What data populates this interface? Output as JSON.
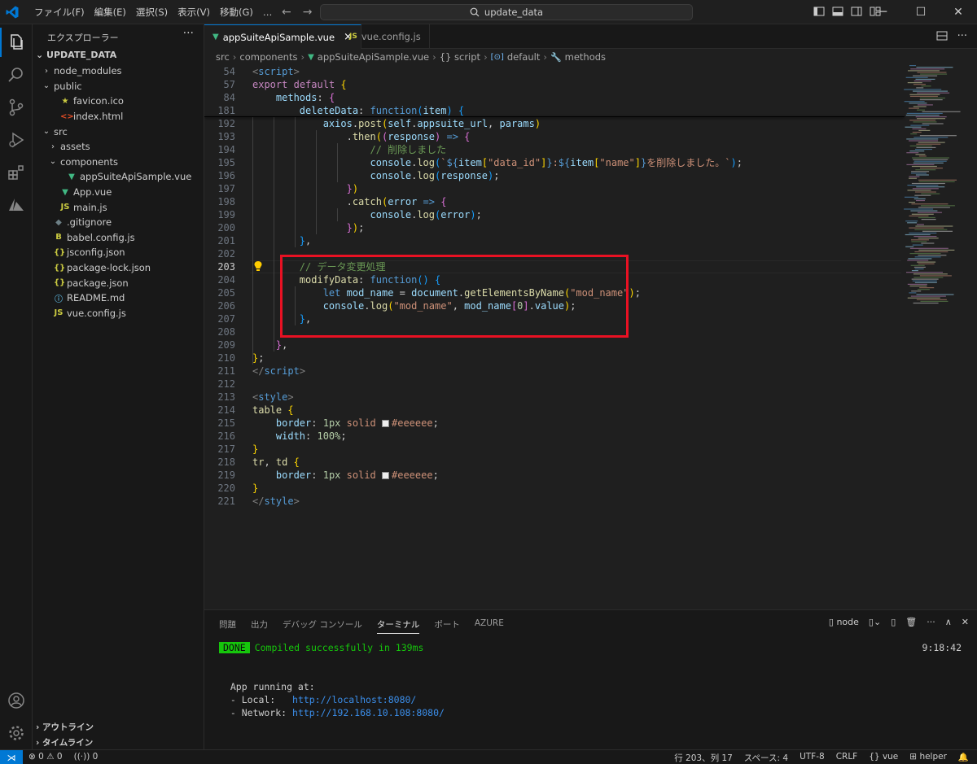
{
  "titlebar": {
    "menus": [
      "ファイル(F)",
      "編集(E)",
      "選択(S)",
      "表示(V)",
      "移動(G)",
      "…"
    ],
    "search_text": "update_data"
  },
  "sidebar": {
    "title": "エクスプローラー",
    "root": "UPDATE_DATA",
    "items": [
      {
        "label": "node_modules",
        "indent": 0,
        "chev": "›",
        "icon": "",
        "color": "#cccccc"
      },
      {
        "label": "public",
        "indent": 0,
        "chev": "⌄",
        "icon": "",
        "color": "#cccccc"
      },
      {
        "label": "favicon.ico",
        "indent": 1,
        "chev": "",
        "icon": "★",
        "color": "#cbcb41"
      },
      {
        "label": "index.html",
        "indent": 1,
        "chev": "",
        "icon": "<>",
        "color": "#e44d26"
      },
      {
        "label": "src",
        "indent": 0,
        "chev": "⌄",
        "icon": "",
        "color": "#cccccc"
      },
      {
        "label": "assets",
        "indent": 1,
        "chev": "›",
        "icon": "",
        "color": "#cccccc"
      },
      {
        "label": "components",
        "indent": 1,
        "chev": "⌄",
        "icon": "",
        "color": "#cccccc"
      },
      {
        "label": "appSuiteApiSample.vue",
        "indent": 2,
        "chev": "",
        "icon": "▼",
        "color": "#41b883"
      },
      {
        "label": "App.vue",
        "indent": 1,
        "chev": "",
        "icon": "▼",
        "color": "#41b883"
      },
      {
        "label": "main.js",
        "indent": 1,
        "chev": "",
        "icon": "JS",
        "color": "#cbcb41"
      },
      {
        "label": ".gitignore",
        "indent": 0,
        "chev": "",
        "icon": "◆",
        "color": "#6d8086"
      },
      {
        "label": "babel.config.js",
        "indent": 0,
        "chev": "",
        "icon": "B",
        "color": "#cbcb41"
      },
      {
        "label": "jsconfig.json",
        "indent": 0,
        "chev": "",
        "icon": "{}",
        "color": "#cbcb41"
      },
      {
        "label": "package-lock.json",
        "indent": 0,
        "chev": "",
        "icon": "{}",
        "color": "#cbcb41"
      },
      {
        "label": "package.json",
        "indent": 0,
        "chev": "",
        "icon": "{}",
        "color": "#cbcb41"
      },
      {
        "label": "README.md",
        "indent": 0,
        "chev": "",
        "icon": "ⓘ",
        "color": "#519aba"
      },
      {
        "label": "vue.config.js",
        "indent": 0,
        "chev": "",
        "icon": "JS",
        "color": "#cbcb41"
      }
    ],
    "outline": "アウトライン",
    "timeline": "タイムライン"
  },
  "tabs": [
    {
      "label": "appSuiteApiSample.vue",
      "icon": "▼",
      "close": "×"
    },
    {
      "label": "vue.config.js",
      "icon": "JS"
    }
  ],
  "breadcrumb": {
    "src": "src",
    "components": "components",
    "file": "appSuiteApiSample.vue",
    "script": "{} script",
    "default": "default",
    "methods": "methods"
  },
  "code": {
    "lines": [
      {
        "n": "54",
        "html": "<span class=\"t\">&lt;</span><span class=\"tag\">script</span><span class=\"t\">&gt;</span>"
      },
      {
        "n": "57",
        "html": "<span class=\"c\">export</span> <span class=\"c\">default</span> <span class=\"b1\">{</span>"
      },
      {
        "n": "84",
        "html": "    <span class=\"v\">methods</span>: <span class=\"b2\">{</span>"
      },
      {
        "n": "181",
        "html": "        <span class=\"v\">deleteData</span>: <span class=\"k\">function</span><span class=\"b3\">(</span><span class=\"v\">item</span><span class=\"b3\">)</span> <span class=\"b3\">{</span>"
      },
      {
        "n": "192",
        "html": "            <span class=\"v\">axios</span>.<span class=\"f\">post</span><span class=\"b1\">(</span><span class=\"v\">self</span>.<span class=\"v\">appsuite_url</span>, <span class=\"v\">params</span><span class=\"b1\">)</span>"
      },
      {
        "n": "193",
        "html": "                .<span class=\"f\">then</span><span class=\"b1\">(</span><span class=\"b2\">(</span><span class=\"v\">response</span><span class=\"b2\">)</span> <span class=\"k\">=&gt;</span> <span class=\"b2\">{</span>"
      },
      {
        "n": "194",
        "html": "                    <span class=\"cm\">// 削除しました</span>"
      },
      {
        "n": "195",
        "html": "                    <span class=\"v\">console</span>.<span class=\"f\">log</span><span class=\"b3\">(</span><span class=\"s\">`</span><span class=\"k\">${</span><span class=\"v\">item</span><span class=\"b1\">[</span><span class=\"s\">\"data_id\"</span><span class=\"b1\">]</span><span class=\"k\">}</span><span class=\"s\">:</span><span class=\"k\">${</span><span class=\"v\">item</span><span class=\"b1\">[</span><span class=\"s\">\"name\"</span><span class=\"b1\">]</span><span class=\"k\">}</span><span class=\"s\">を削除しました。`</span><span class=\"b3\">)</span>;"
      },
      {
        "n": "196",
        "html": "                    <span class=\"v\">console</span>.<span class=\"f\">log</span><span class=\"b3\">(</span><span class=\"v\">response</span><span class=\"b3\">)</span>;"
      },
      {
        "n": "197",
        "html": "                <span class=\"b2\">}</span><span class=\"b1\">)</span>"
      },
      {
        "n": "198",
        "html": "                .<span class=\"f\">catch</span><span class=\"b1\">(</span><span class=\"v\">error</span> <span class=\"k\">=&gt;</span> <span class=\"b2\">{</span>"
      },
      {
        "n": "199",
        "html": "                    <span class=\"v\">console</span>.<span class=\"f\">log</span><span class=\"b3\">(</span><span class=\"v\">error</span><span class=\"b3\">)</span>;"
      },
      {
        "n": "200",
        "html": "                <span class=\"b2\">}</span><span class=\"b1\">)</span>;"
      },
      {
        "n": "201",
        "html": "        <span class=\"b3\">}</span>,"
      },
      {
        "n": "202",
        "html": ""
      },
      {
        "n": "203",
        "html": "        <span class=\"cm\">// データ変更処理</span>"
      },
      {
        "n": "204",
        "html": "        <span class=\"f\">modifyData</span>: <span class=\"k\">function</span><span class=\"b3\">()</span> <span class=\"b3\">{</span>"
      },
      {
        "n": "205",
        "html": "            <span class=\"k\">let</span> <span class=\"v\">mod_name</span> = <span class=\"v\">document</span>.<span class=\"f\">getElementsByName</span><span class=\"b1\">(</span><span class=\"s\">\"mod_name\"</span><span class=\"b1\">)</span>;"
      },
      {
        "n": "206",
        "html": "            <span class=\"v\">console</span>.<span class=\"f\">log</span><span class=\"b1\">(</span><span class=\"s\">\"mod_name\"</span>, <span class=\"v\">mod_name</span><span class=\"b2\">[</span><span class=\"n\">0</span><span class=\"b2\">]</span>.<span class=\"v\">value</span><span class=\"b1\">)</span>;"
      },
      {
        "n": "207",
        "html": "        <span class=\"b3\">}</span>,"
      },
      {
        "n": "208",
        "html": ""
      },
      {
        "n": "209",
        "html": "    <span class=\"b2\">}</span>,"
      },
      {
        "n": "210",
        "html": "<span class=\"b1\">}</span>;"
      },
      {
        "n": "211",
        "html": "<span class=\"t\">&lt;/</span><span class=\"tag\">script</span><span class=\"t\">&gt;</span>"
      },
      {
        "n": "212",
        "html": ""
      },
      {
        "n": "213",
        "html": "<span class=\"t\">&lt;</span><span class=\"tag\">style</span><span class=\"t\">&gt;</span>"
      },
      {
        "n": "214",
        "html": "<span class=\"f\">table</span> <span class=\"b1\">{</span>"
      },
      {
        "n": "215",
        "html": "    <span class=\"v\">border</span>: <span class=\"n\">1px</span> <span class=\"s\">solid</span> <span class=\"sq\"></span><span class=\"s\">#eeeeee</span>;"
      },
      {
        "n": "216",
        "html": "    <span class=\"v\">width</span>: <span class=\"n\">100%</span>;"
      },
      {
        "n": "217",
        "html": "<span class=\"b1\">}</span>"
      },
      {
        "n": "218",
        "html": "<span class=\"f\">tr</span>, <span class=\"f\">td</span> <span class=\"b1\">{</span>"
      },
      {
        "n": "219",
        "html": "    <span class=\"v\">border</span>: <span class=\"n\">1px</span> <span class=\"s\">solid</span> <span class=\"sq\"></span><span class=\"s\">#eeeeee</span>;"
      },
      {
        "n": "220",
        "html": "<span class=\"b1\">}</span>"
      },
      {
        "n": "221",
        "html": "<span class=\"t\">&lt;/</span><span class=\"tag\">style</span><span class=\"t\">&gt;</span>"
      }
    ]
  },
  "panel": {
    "tabs": [
      "問題",
      "出力",
      "デバッグ コンソール",
      "ターミナル",
      "ポート",
      "AZURE"
    ],
    "active_tab": "ターミナル",
    "terminal_profile": "node",
    "terminal": {
      "done": "DONE",
      "compiled": "Compiled successfully in 139ms",
      "time": "9:18:42",
      "running": "  App running at:",
      "local_label": "  - Local:   ",
      "local_url": "http://localhost:8080/",
      "network_label": "  - Network: ",
      "network_url": "http://192.168.10.108:8080/"
    }
  },
  "statusbar": {
    "errors": "⊗ 0 ⚠ 0",
    "ports": "0",
    "position": "行 203、列 17",
    "spaces": "スペース: 4",
    "encoding": "UTF-8",
    "eol": "CRLF",
    "language": "vue",
    "helper": "helper"
  },
  "colors": {
    "accent": "#0078d4",
    "highlight_box": "#e81123",
    "vue_green": "#41b883"
  }
}
